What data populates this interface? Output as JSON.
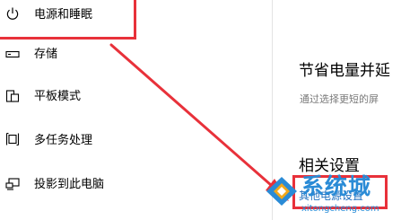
{
  "sidebar": {
    "items": [
      {
        "label": "电源和睡眠",
        "icon": "power-icon"
      },
      {
        "label": "存储",
        "icon": "storage-icon"
      },
      {
        "label": "平板模式",
        "icon": "tablet-mode-icon"
      },
      {
        "label": "多任务处理",
        "icon": "multitasking-icon"
      },
      {
        "label": "投影到此电脑",
        "icon": "project-to-pc-icon"
      }
    ]
  },
  "main": {
    "heading": "节省电量并延",
    "description": "通过选择更短的屏",
    "related_heading": "相关设置",
    "related_link": "其他电源设置"
  },
  "watermark": {
    "text": "系统城",
    "url": "xitongcheng.com"
  },
  "colors": {
    "annotation": "#e8313a",
    "link": "#1f6fbf",
    "watermark": "#2a8bd6"
  }
}
